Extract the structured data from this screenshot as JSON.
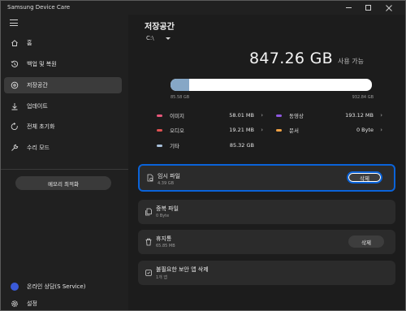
{
  "window": {
    "title": "Samsung Device Care"
  },
  "sidebar": {
    "items": [
      {
        "label": "홈",
        "icon": "home-icon"
      },
      {
        "label": "백업 및 복원",
        "icon": "history-icon"
      },
      {
        "label": "저장공간",
        "icon": "storage-icon",
        "active": true
      },
      {
        "label": "업데이트",
        "icon": "download-icon"
      },
      {
        "label": "전체 초기화",
        "icon": "reset-icon"
      },
      {
        "label": "수리 모드",
        "icon": "wrench-icon"
      }
    ],
    "memory_button": "메모리 최적화",
    "service_label": "온라인 상담(S Service)",
    "settings_label": "설정"
  },
  "main": {
    "title": "저장공간",
    "drive": "C:\\",
    "available_value": "847.26 GB",
    "available_label": "사용 가능",
    "used_fraction": 0.092,
    "bar_min": "85.58 GB",
    "bar_max": "932.84 GB",
    "categories": [
      {
        "name": "이미지",
        "value": "58.01 MB",
        "color": "#e8577a",
        "chevron": true
      },
      {
        "name": "동영상",
        "value": "193.12 MB",
        "color": "#8f57e0",
        "chevron": true
      },
      {
        "name": "오디오",
        "value": "19.21 MB",
        "color": "#e05252",
        "chevron": true
      },
      {
        "name": "문서",
        "value": "0 Byte",
        "color": "#f0a144",
        "chevron": true
      },
      {
        "name": "기타",
        "value": "85.32 GB",
        "color": "#a8c0da",
        "chevron": false
      }
    ],
    "cards": [
      {
        "title": "임시 파일",
        "sub": "4.39 GB",
        "button": "삭제",
        "icon": "temp-file-icon"
      },
      {
        "title": "중복 파일",
        "sub": "0 Byte",
        "icon": "duplicate-file-icon"
      },
      {
        "title": "휴지통",
        "sub": "65.85 MB",
        "button": "삭제",
        "icon": "trash-icon"
      },
      {
        "title": "불필요한 보안 앱 삭제",
        "sub": "1개 앱",
        "icon": "security-app-icon"
      }
    ]
  }
}
